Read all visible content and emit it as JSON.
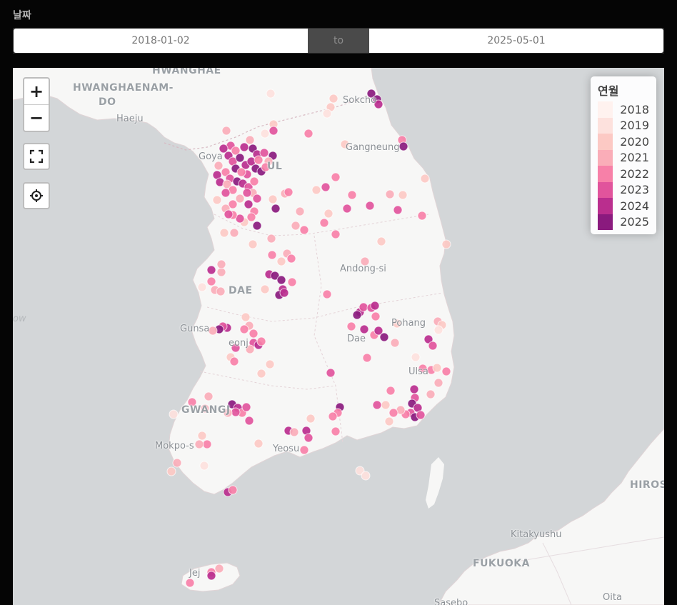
{
  "filter": {
    "label": "날짜",
    "start_date": "2018-01-02",
    "separator": "to",
    "end_date": "2025-05-01"
  },
  "map": {
    "controls": {
      "zoom_in": "+",
      "zoom_out": "−"
    },
    "legend": {
      "title": "연월",
      "items": [
        {
          "label": "2018",
          "color": "#fff2ef"
        },
        {
          "label": "2019",
          "color": "#fde1dd"
        },
        {
          "label": "2020",
          "color": "#fcc9c4"
        },
        {
          "label": "2021",
          "color": "#faadb8"
        },
        {
          "label": "2022",
          "color": "#f780a8"
        },
        {
          "label": "2023",
          "color": "#e1549c"
        },
        {
          "label": "2024",
          "color": "#ba2e8e"
        },
        {
          "label": "2025",
          "color": "#8a1a7e"
        }
      ]
    },
    "places": [
      {
        "key": "hwanghae",
        "text": "HWANGHAE",
        "size": "big"
      },
      {
        "key": "hwanghaenam",
        "text": "HWANGHAENAM-",
        "size": "big"
      },
      {
        "key": "do",
        "text": "DO",
        "size": "big"
      },
      {
        "key": "haeju",
        "text": "Haeju",
        "size": "small"
      },
      {
        "key": "sokcho",
        "text": "Sokcho",
        "size": "small"
      },
      {
        "key": "gangneung",
        "text": "Gangneung",
        "size": "small"
      },
      {
        "key": "goyang",
        "text": "Goya",
        "size": "small"
      },
      {
        "key": "seoul",
        "text": "UL",
        "size": "big"
      },
      {
        "key": "andong",
        "text": "Andong-si",
        "size": "small"
      },
      {
        "key": "daejeon",
        "text": "DAE",
        "size": "big"
      },
      {
        "key": "pohang",
        "text": "Pohang",
        "size": "small"
      },
      {
        "key": "gunsan",
        "text": "Gunsa",
        "size": "small"
      },
      {
        "key": "jeonju",
        "text": "eonj",
        "size": "small"
      },
      {
        "key": "daegu",
        "text": "Dae",
        "size": "small"
      },
      {
        "key": "ulsan",
        "text": "Ulsa",
        "size": "small"
      },
      {
        "key": "gwangju",
        "text": "GWANGJ",
        "size": "big"
      },
      {
        "key": "busan",
        "text": "",
        "size": "small"
      },
      {
        "key": "mokpo",
        "text": "Mokpo-s",
        "size": "small"
      },
      {
        "key": "yeosu",
        "text": "Yeosu",
        "size": "small"
      },
      {
        "key": "jeju",
        "text": "Jej",
        "size": "small"
      },
      {
        "key": "kitakyushu",
        "text": "Kitakyushu",
        "size": "small"
      },
      {
        "key": "fukuoka",
        "text": "FUKUOKA",
        "size": "big"
      },
      {
        "key": "hiroshima",
        "text": "HIROSH",
        "size": "big"
      },
      {
        "key": "oita",
        "text": "Oita",
        "size": "small"
      },
      {
        "key": "sasebo",
        "text": "Sasebo",
        "size": "small"
      },
      {
        "key": "yellowsea",
        "text": "ow",
        "size": "sea"
      }
    ],
    "points": [
      [
        379,
        131,
        "2019"
      ],
      [
        520,
        131,
        "2025"
      ],
      [
        528,
        139,
        "2025"
      ],
      [
        530,
        146,
        "2024"
      ],
      [
        467,
        138,
        "2020"
      ],
      [
        463,
        150,
        "2020"
      ],
      [
        458,
        159,
        "2019"
      ],
      [
        383,
        174,
        "2020"
      ],
      [
        371,
        187,
        "2019"
      ],
      [
        383,
        183,
        "2023"
      ],
      [
        432,
        187,
        "2022"
      ],
      [
        317,
        183,
        "2021"
      ],
      [
        563,
        196,
        "2022"
      ],
      [
        565,
        205,
        "2025"
      ],
      [
        483,
        202,
        "2020"
      ],
      [
        323,
        204,
        "2023"
      ],
      [
        313,
        208,
        "2024"
      ],
      [
        330,
        211,
        "2022"
      ],
      [
        342,
        206,
        "2024"
      ],
      [
        350,
        196,
        "2021"
      ],
      [
        354,
        208,
        "2025"
      ],
      [
        360,
        216,
        "2024"
      ],
      [
        370,
        214,
        "2023"
      ],
      [
        382,
        218,
        "2025"
      ],
      [
        376,
        226,
        "2021"
      ],
      [
        320,
        218,
        "2024"
      ],
      [
        326,
        226,
        "2023"
      ],
      [
        336,
        221,
        "2025"
      ],
      [
        344,
        231,
        "2024"
      ],
      [
        352,
        226,
        "2024"
      ],
      [
        358,
        236,
        "2025"
      ],
      [
        366,
        240,
        "2025"
      ],
      [
        362,
        224,
        "2022"
      ],
      [
        372,
        234,
        "2022"
      ],
      [
        346,
        244,
        "2023"
      ],
      [
        306,
        232,
        "2021"
      ],
      [
        316,
        241,
        "2022"
      ],
      [
        322,
        250,
        "2023"
      ],
      [
        330,
        236,
        "2025"
      ],
      [
        338,
        241,
        "2022"
      ],
      [
        304,
        245,
        "2024"
      ],
      [
        308,
        255,
        "2024"
      ],
      [
        318,
        258,
        "2021"
      ],
      [
        326,
        266,
        "2022"
      ],
      [
        332,
        254,
        "2025"
      ],
      [
        340,
        257,
        "2024"
      ],
      [
        348,
        262,
        "2023"
      ],
      [
        356,
        254,
        "2022"
      ],
      [
        354,
        270,
        "2021"
      ],
      [
        360,
        278,
        "2023"
      ],
      [
        346,
        270,
        "2023"
      ],
      [
        336,
        278,
        "2021"
      ],
      [
        326,
        286,
        "2022"
      ],
      [
        316,
        292,
        "2021"
      ],
      [
        304,
        280,
        "2020"
      ],
      [
        316,
        270,
        "2023"
      ],
      [
        348,
        286,
        "2024"
      ],
      [
        356,
        296,
        "2022"
      ],
      [
        352,
        304,
        "2022"
      ],
      [
        360,
        316,
        "2025"
      ],
      [
        342,
        311,
        "2020"
      ],
      [
        336,
        306,
        "2023"
      ],
      [
        326,
        301,
        "2022"
      ],
      [
        320,
        300,
        "2023"
      ],
      [
        382,
        279,
        "2020"
      ],
      [
        386,
        292,
        "2025"
      ],
      [
        399,
        271,
        "2021"
      ],
      [
        404,
        269,
        "2022"
      ],
      [
        420,
        296,
        "2021"
      ],
      [
        443,
        266,
        "2020"
      ],
      [
        456,
        262,
        "2023"
      ],
      [
        470,
        248,
        "2022"
      ],
      [
        493,
        273,
        "2022"
      ],
      [
        486,
        292,
        "2023"
      ],
      [
        518,
        288,
        "2023"
      ],
      [
        546,
        272,
        "2021"
      ],
      [
        564,
        273,
        "2020"
      ],
      [
        595,
        250,
        "2020"
      ],
      [
        557,
        294,
        "2023"
      ],
      [
        591,
        302,
        "2022"
      ],
      [
        414,
        316,
        "2021"
      ],
      [
        426,
        322,
        "2022"
      ],
      [
        454,
        312,
        "2022"
      ],
      [
        470,
        328,
        "2022"
      ],
      [
        460,
        299,
        "2020"
      ],
      [
        534,
        338,
        "2020"
      ],
      [
        625,
        342,
        "2020"
      ],
      [
        314,
        326,
        "2020"
      ],
      [
        328,
        326,
        "2021"
      ],
      [
        354,
        342,
        "2020"
      ],
      [
        380,
        334,
        "2021"
      ],
      [
        381,
        357,
        "2022"
      ],
      [
        402,
        355,
        "2021"
      ],
      [
        408,
        362,
        "2022"
      ],
      [
        394,
        366,
        "2020"
      ],
      [
        377,
        384,
        "2024"
      ],
      [
        385,
        386,
        "2025"
      ],
      [
        394,
        392,
        "2025"
      ],
      [
        396,
        405,
        "2024"
      ],
      [
        391,
        413,
        "2025"
      ],
      [
        398,
        410,
        "2024"
      ],
      [
        409,
        395,
        "2022"
      ],
      [
        371,
        405,
        "2020"
      ],
      [
        296,
        378,
        "2024"
      ],
      [
        310,
        381,
        "2021"
      ],
      [
        296,
        394,
        "2022"
      ],
      [
        301,
        406,
        "2021"
      ],
      [
        283,
        402,
        "2019"
      ],
      [
        309,
        408,
        "2021"
      ],
      [
        310,
        370,
        "2021"
      ],
      [
        511,
        366,
        "2021"
      ],
      [
        458,
        412,
        "2022"
      ],
      [
        504,
        437,
        "2024"
      ],
      [
        509,
        430,
        "2023"
      ],
      [
        500,
        441,
        "2025"
      ],
      [
        520,
        431,
        "2023"
      ],
      [
        525,
        428,
        "2024"
      ],
      [
        526,
        443,
        "2022"
      ],
      [
        556,
        453,
        "2020"
      ],
      [
        613,
        450,
        "2021"
      ],
      [
        619,
        455,
        "2020"
      ],
      [
        614,
        462,
        "2019"
      ],
      [
        344,
        444,
        "2020"
      ],
      [
        349,
        456,
        "2021"
      ],
      [
        355,
        467,
        "2022"
      ],
      [
        318,
        459,
        "2024"
      ],
      [
        312,
        457,
        "2023"
      ],
      [
        307,
        461,
        "2025"
      ],
      [
        298,
        463,
        "2021"
      ],
      [
        342,
        461,
        "2022"
      ],
      [
        355,
        480,
        "2023"
      ],
      [
        362,
        483,
        "2024"
      ],
      [
        366,
        478,
        "2022"
      ],
      [
        330,
        487,
        "2023"
      ],
      [
        350,
        489,
        "2021"
      ],
      [
        323,
        500,
        "2020"
      ],
      [
        328,
        506,
        "2022"
      ],
      [
        378,
        510,
        "2020"
      ],
      [
        366,
        523,
        "2020"
      ],
      [
        492,
        457,
        "2022"
      ],
      [
        510,
        461,
        "2024"
      ],
      [
        524,
        469,
        "2022"
      ],
      [
        530,
        463,
        "2024"
      ],
      [
        538,
        472,
        "2025"
      ],
      [
        553,
        480,
        "2021"
      ],
      [
        600,
        475,
        "2024"
      ],
      [
        606,
        484,
        "2023"
      ],
      [
        514,
        501,
        "2022"
      ],
      [
        463,
        522,
        "2023"
      ],
      [
        582,
        500,
        "2019"
      ],
      [
        592,
        516,
        "2022"
      ],
      [
        604,
        518,
        "2022"
      ],
      [
        612,
        515,
        "2020"
      ],
      [
        625,
        520,
        "2022"
      ],
      [
        614,
        536,
        "2021"
      ],
      [
        580,
        545,
        "2024"
      ],
      [
        581,
        557,
        "2023"
      ],
      [
        577,
        565,
        "2025"
      ],
      [
        585,
        571,
        "2024"
      ],
      [
        575,
        578,
        "2023"
      ],
      [
        581,
        584,
        "2025"
      ],
      [
        589,
        581,
        "2023"
      ],
      [
        568,
        580,
        "2022"
      ],
      [
        561,
        574,
        "2021"
      ],
      [
        551,
        578,
        "2022"
      ],
      [
        540,
        567,
        "2020"
      ],
      [
        528,
        567,
        "2023"
      ],
      [
        547,
        547,
        "2022"
      ],
      [
        603,
        552,
        "2021"
      ],
      [
        545,
        590,
        "2020"
      ],
      [
        292,
        555,
        "2021"
      ],
      [
        269,
        563,
        "2022"
      ],
      [
        243,
        580,
        "2019"
      ],
      [
        287,
        572,
        "2021"
      ],
      [
        325,
        566,
        "2025"
      ],
      [
        333,
        571,
        "2024"
      ],
      [
        339,
        578,
        "2022"
      ],
      [
        345,
        570,
        "2023"
      ],
      [
        330,
        577,
        "2023"
      ],
      [
        349,
        589,
        "2023"
      ],
      [
        319,
        578,
        "2021"
      ],
      [
        476,
        570,
        "2025"
      ],
      [
        473,
        578,
        "2022"
      ],
      [
        466,
        583,
        "2022"
      ],
      [
        435,
        586,
        "2020"
      ],
      [
        404,
        603,
        "2024"
      ],
      [
        429,
        603,
        "2024"
      ],
      [
        432,
        613,
        "2023"
      ],
      [
        412,
        605,
        "2021"
      ],
      [
        470,
        604,
        "2022"
      ],
      [
        426,
        630,
        "2022"
      ],
      [
        283,
        610,
        "2020"
      ],
      [
        290,
        622,
        "2022"
      ],
      [
        279,
        622,
        "2021"
      ],
      [
        362,
        621,
        "2020"
      ],
      [
        248,
        648,
        "2021"
      ],
      [
        240,
        660,
        "2020"
      ],
      [
        286,
        652,
        "2019"
      ],
      [
        319,
        689,
        "2024"
      ],
      [
        326,
        686,
        "2022"
      ],
      [
        504,
        659,
        "2019"
      ],
      [
        512,
        666,
        "2019"
      ],
      [
        296,
        801,
        "2022"
      ],
      [
        307,
        796,
        "2021"
      ],
      [
        296,
        806,
        "2024"
      ],
      [
        266,
        816,
        "2022"
      ]
    ]
  }
}
